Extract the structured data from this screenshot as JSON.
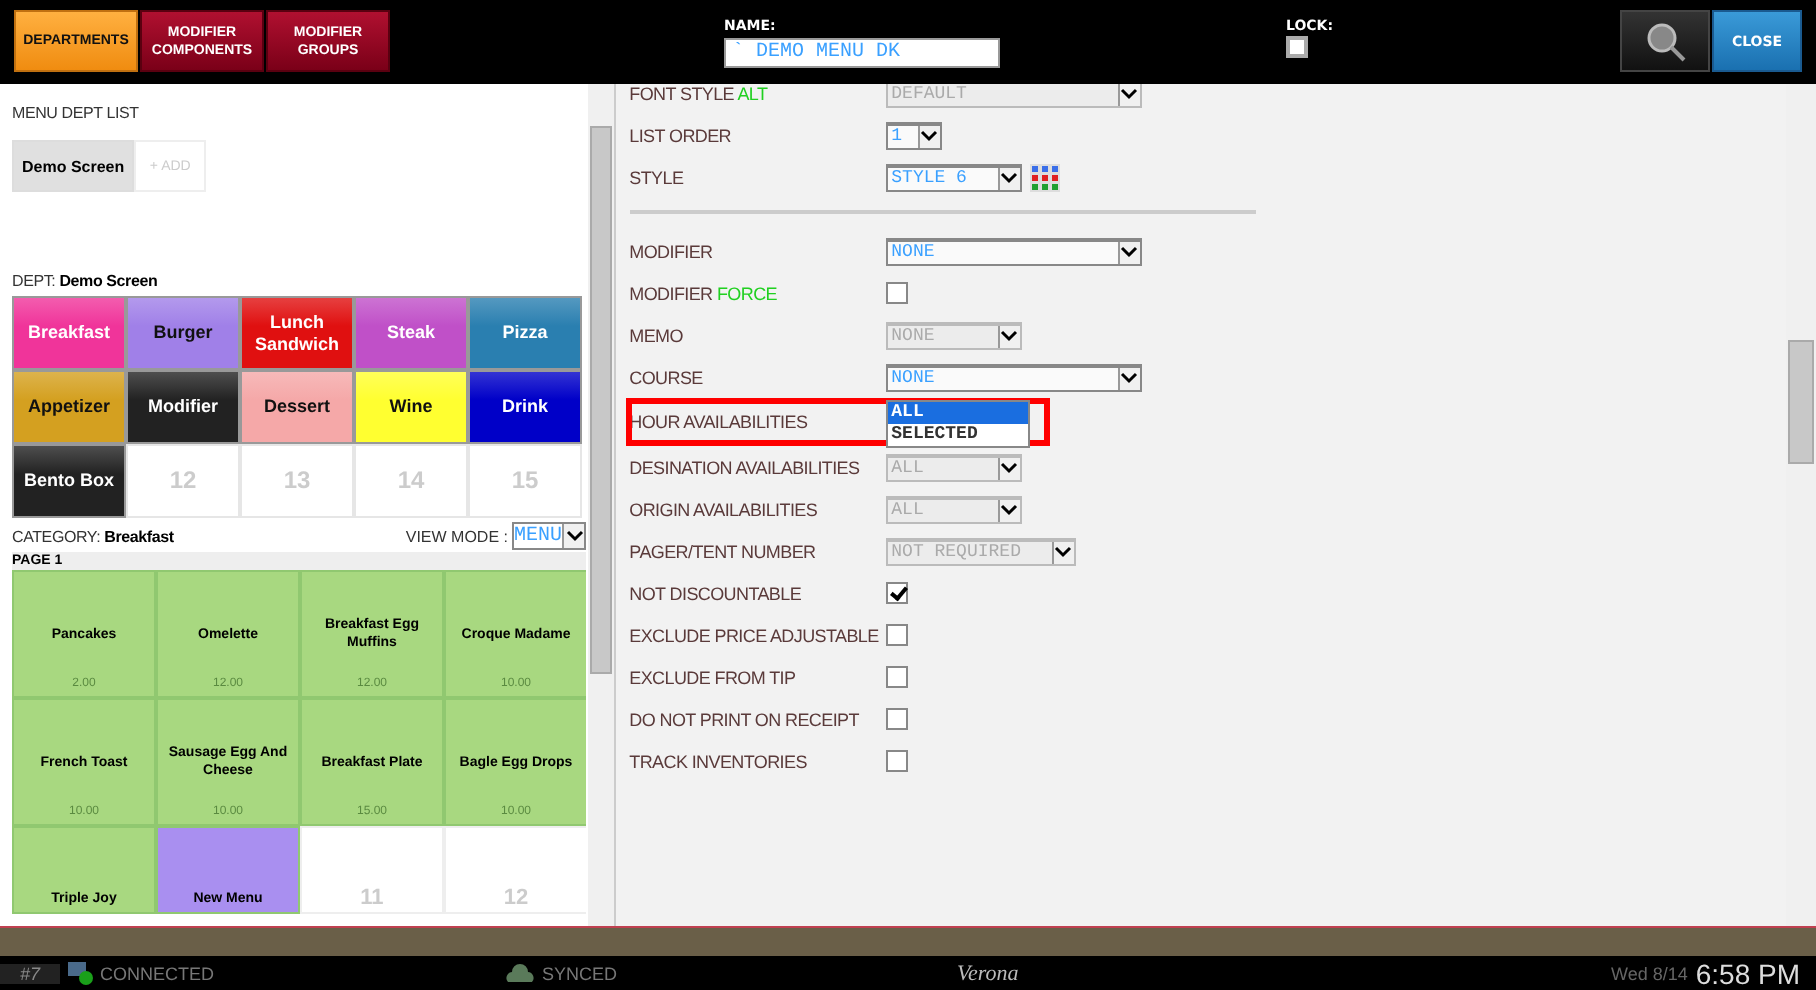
{
  "top_bar": {
    "tabs": [
      {
        "label": "DEPARTMENTS",
        "selected": true
      },
      {
        "label": "MODIFIER COMPONENTS",
        "selected": false
      },
      {
        "label": "MODIFIER GROUPS",
        "selected": false
      }
    ],
    "name_field": {
      "label": "NAME:",
      "value": "` DEMO MENU DK"
    },
    "lock": {
      "label": "LOCK:",
      "checked": false
    },
    "close_button": "CLOSE"
  },
  "dept_list": {
    "title": "MENU DEPT LIST",
    "items": [
      {
        "label": "Demo Screen",
        "selected": true
      }
    ],
    "add_button": "+ ADD"
  },
  "dept": {
    "label": "DEPT:",
    "value": "Demo Screen"
  },
  "departments": [
    {
      "kind": "dept",
      "label": "Breakfast",
      "color": "#f0349a"
    },
    {
      "kind": "dept",
      "label": "Burger",
      "color": "#a080e8"
    },
    {
      "kind": "dept",
      "label": "Lunch Sandwich",
      "color": "#e01010"
    },
    {
      "kind": "dept",
      "label": "Steak",
      "color": "#c050c8"
    },
    {
      "kind": "dept",
      "label": "Pizza",
      "color": "#2a7fb0"
    },
    {
      "kind": "dept",
      "label": "Appetizer",
      "color": "#d4a020"
    },
    {
      "kind": "dept",
      "label": "Modifier",
      "color": "#222222"
    },
    {
      "kind": "dept",
      "label": "Dessert",
      "color": "#f5a8a8"
    },
    {
      "kind": "dept",
      "label": "Wine",
      "color": "#ffff30"
    },
    {
      "kind": "dept",
      "label": "Drink",
      "color": "#0000c8"
    },
    {
      "kind": "dept",
      "label": "Bento Box",
      "color": "#222222"
    },
    {
      "kind": "empty",
      "label": "12"
    },
    {
      "kind": "empty",
      "label": "13"
    },
    {
      "kind": "empty",
      "label": "14"
    },
    {
      "kind": "empty",
      "label": "15"
    }
  ],
  "category": {
    "label": "CATEGORY:",
    "value": "Breakfast",
    "view_mode_label": "VIEW MODE :",
    "view_mode": "MENU"
  },
  "page_label": "PAGE 1",
  "items": [
    {
      "kind": "item",
      "name": "Pancakes",
      "price": "2.00",
      "color": "#a8d880"
    },
    {
      "kind": "item",
      "name": "Omelette",
      "price": "12.00",
      "color": "#a8d880"
    },
    {
      "kind": "item",
      "name": "Breakfast Egg Muffins",
      "price": "12.00",
      "color": "#a8d880"
    },
    {
      "kind": "item",
      "name": "Croque Madame",
      "price": "10.00",
      "color": "#a8d880"
    },
    {
      "kind": "item",
      "name": "French Toast",
      "price": "10.00",
      "color": "#a8d880"
    },
    {
      "kind": "item",
      "name": "Sausage Egg And Cheese",
      "price": "10.00",
      "color": "#a8d880"
    },
    {
      "kind": "item",
      "name": "Breakfast Plate",
      "price": "15.00",
      "color": "#a8d880"
    },
    {
      "kind": "item",
      "name": "Bagle Egg Drops",
      "price": "10.00",
      "color": "#a8d880"
    },
    {
      "kind": "item",
      "name": "Triple Joy",
      "color": "#a8d880"
    },
    {
      "kind": "item",
      "name": "New Menu",
      "color": "#a98ff0"
    },
    {
      "kind": "empty",
      "name": "11"
    },
    {
      "kind": "empty",
      "name": "12"
    }
  ],
  "form": [
    {
      "kind": "select",
      "label": "FONT STYLE",
      "accent": "ALT",
      "value": "DEFAULT",
      "disabled": true
    },
    {
      "kind": "select",
      "label": "LIST ORDER",
      "value": "1",
      "disabled": false
    },
    {
      "kind": "select",
      "label": "STYLE",
      "value": "STYLE 6",
      "disabled": false,
      "palette": true
    },
    {
      "kind": "divider"
    },
    {
      "kind": "select",
      "label": "MODIFIER",
      "value": "NONE",
      "disabled": false
    },
    {
      "kind": "checkbox",
      "label": "MODIFIER",
      "accent": "FORCE",
      "checked": false
    },
    {
      "kind": "select",
      "label": "MEMO",
      "value": "NONE",
      "disabled": true
    },
    {
      "kind": "select",
      "label": "COURSE",
      "value": "NONE",
      "disabled": false
    },
    {
      "kind": "open_select",
      "label": "HOUR AVAILABILITIES",
      "options": [
        {
          "label": "ALL",
          "selected": true
        },
        {
          "label": "SELECTED",
          "selected": false
        }
      ]
    },
    {
      "kind": "select",
      "label": "DESINATION AVAILABILITIES",
      "value": "ALL",
      "disabled": true
    },
    {
      "kind": "select",
      "label": "ORIGIN AVAILABILITIES",
      "value": "ALL",
      "disabled": true
    },
    {
      "kind": "select",
      "label": "PAGER/TENT NUMBER",
      "value": "NOT REQUIRED",
      "disabled": true
    },
    {
      "kind": "checkbox",
      "label": "NOT DISCOUNTABLE",
      "checked": true
    },
    {
      "kind": "checkbox",
      "label": "EXCLUDE PRICE ADJUSTABLE",
      "checked": false
    },
    {
      "kind": "checkbox",
      "label": "EXCLUDE FROM TIP",
      "checked": false
    },
    {
      "kind": "checkbox",
      "label": "DO NOT PRINT ON RECEIPT",
      "checked": false
    },
    {
      "kind": "checkbox",
      "label": "TRACK INVENTORIES",
      "checked": false
    }
  ],
  "status_bar": {
    "terminal": "#7",
    "connection": "CONNECTED",
    "sync": "SYNCED",
    "brand": "Verona",
    "date": "Wed 8/14",
    "time": "6:58 PM"
  }
}
